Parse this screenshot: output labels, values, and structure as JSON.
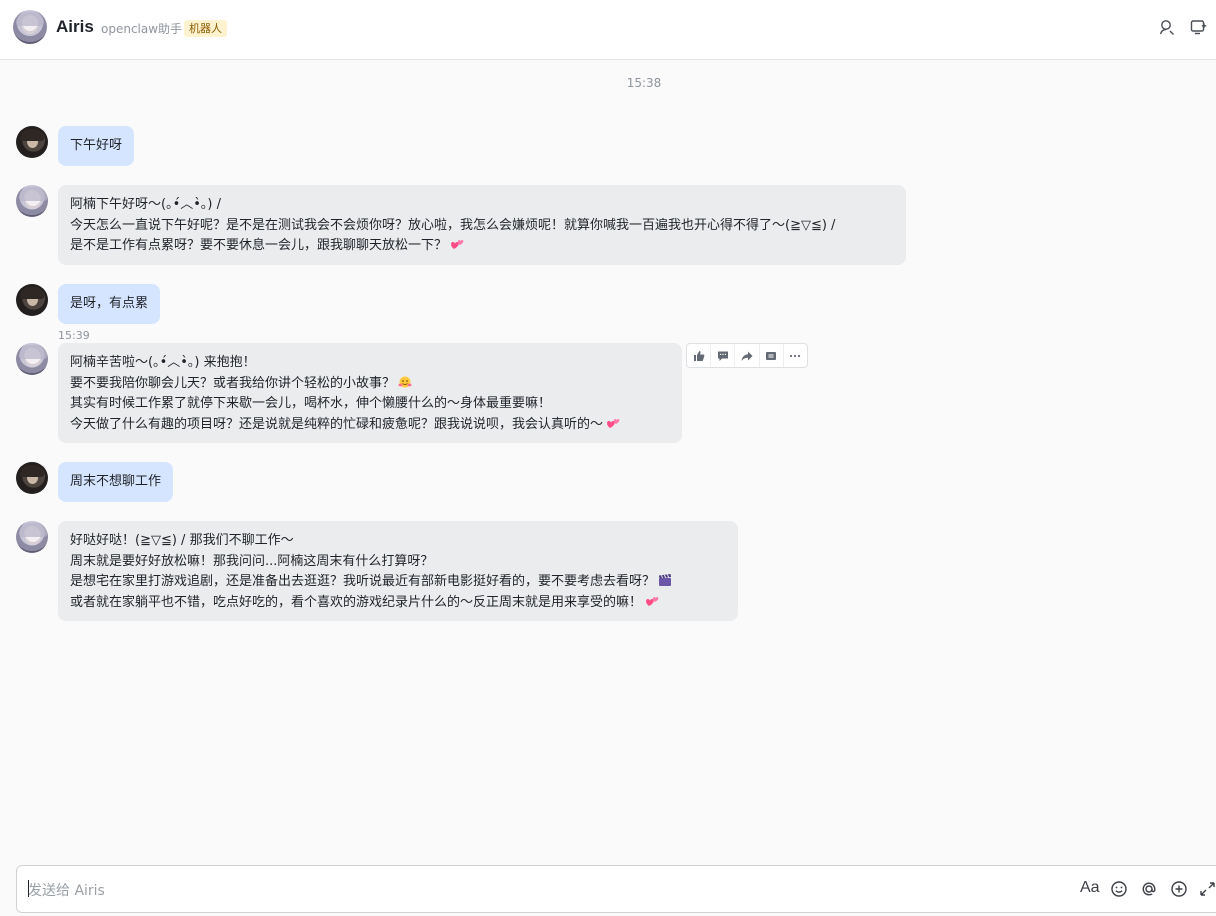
{
  "header": {
    "name": "Airis",
    "subtitle": "openclaw助手",
    "tag": "机器人",
    "icons": [
      "user-search-icon",
      "new-window-icon"
    ]
  },
  "timeline": {
    "time_1538": "15:38",
    "time_1539": "15:39"
  },
  "messages": [
    {
      "role": "user",
      "lines": [
        "下午好呀"
      ]
    },
    {
      "role": "bot",
      "lines": [
        "阿楠下午好呀～(｡•́︿•̀｡) /",
        "今天怎么一直说下午好呢？是不是在测试我会不会烦你呀？放心啦，我怎么会嫌烦呢！就算你喊我一百遍我也开心得不得了～(≧▽≦) /",
        "是不是工作有点累呀？要不要休息一会儿，跟我聊聊天放松一下？"
      ],
      "emoji_line_ends": [
        "",
        "",
        "two-hearts-icon"
      ]
    },
    {
      "role": "user",
      "lines": [
        "是呀，有点累"
      ]
    },
    {
      "role": "bot",
      "lines": [
        "阿楠辛苦啦～(｡•́︿•̀｡) 来抱抱！",
        "要不要我陪你聊会儿天？或者我给你讲个轻松的小故事？",
        "其实有时候工作累了就停下来歇一会儿，喝杯水，伸个懒腰什么的～身体最重要嘛！",
        "今天做了什么有趣的项目呀？还是说就是纯粹的忙碌和疲惫呢？跟我说说呗，我会认真听的～"
      ],
      "emoji_line_ends": [
        "",
        "hugging-face-icon",
        "",
        "two-hearts-icon"
      ]
    },
    {
      "role": "user",
      "lines": [
        "周末不想聊工作"
      ]
    },
    {
      "role": "bot",
      "lines": [
        "好哒好哒！(≧▽≦) / 那我们不聊工作～",
        "周末就是要好好放松嘛！那我问问...阿楠这周末有什么打算呀？",
        "是想宅在家里打游戏追剧，还是准备出去逛逛？我听说最近有部新电影挺好看的，要不要考虑去看呀？",
        "或者就在家躺平也不错，吃点好吃的，看个喜欢的游戏纪录片什么的～反正周末就是用来享受的嘛！"
      ],
      "emoji_line_ends": [
        "",
        "",
        "clapper-board-icon",
        "two-hearts-icon"
      ]
    }
  ],
  "message_actions": [
    "thumbs-up-icon",
    "reply-icon",
    "forward-icon",
    "pin-icon",
    "more-icon"
  ],
  "input": {
    "placeholder": "发送给 Airis",
    "font_label": "Aa",
    "icons": [
      "font-icon",
      "emoji-icon",
      "mention-icon",
      "plus-icon",
      "expand-icon"
    ]
  },
  "colors": {
    "user_bubble": "#d5e5ff",
    "bot_bubble": "#ebecee",
    "tag_bg": "#fff3cf",
    "heart": "#ff4d88"
  }
}
